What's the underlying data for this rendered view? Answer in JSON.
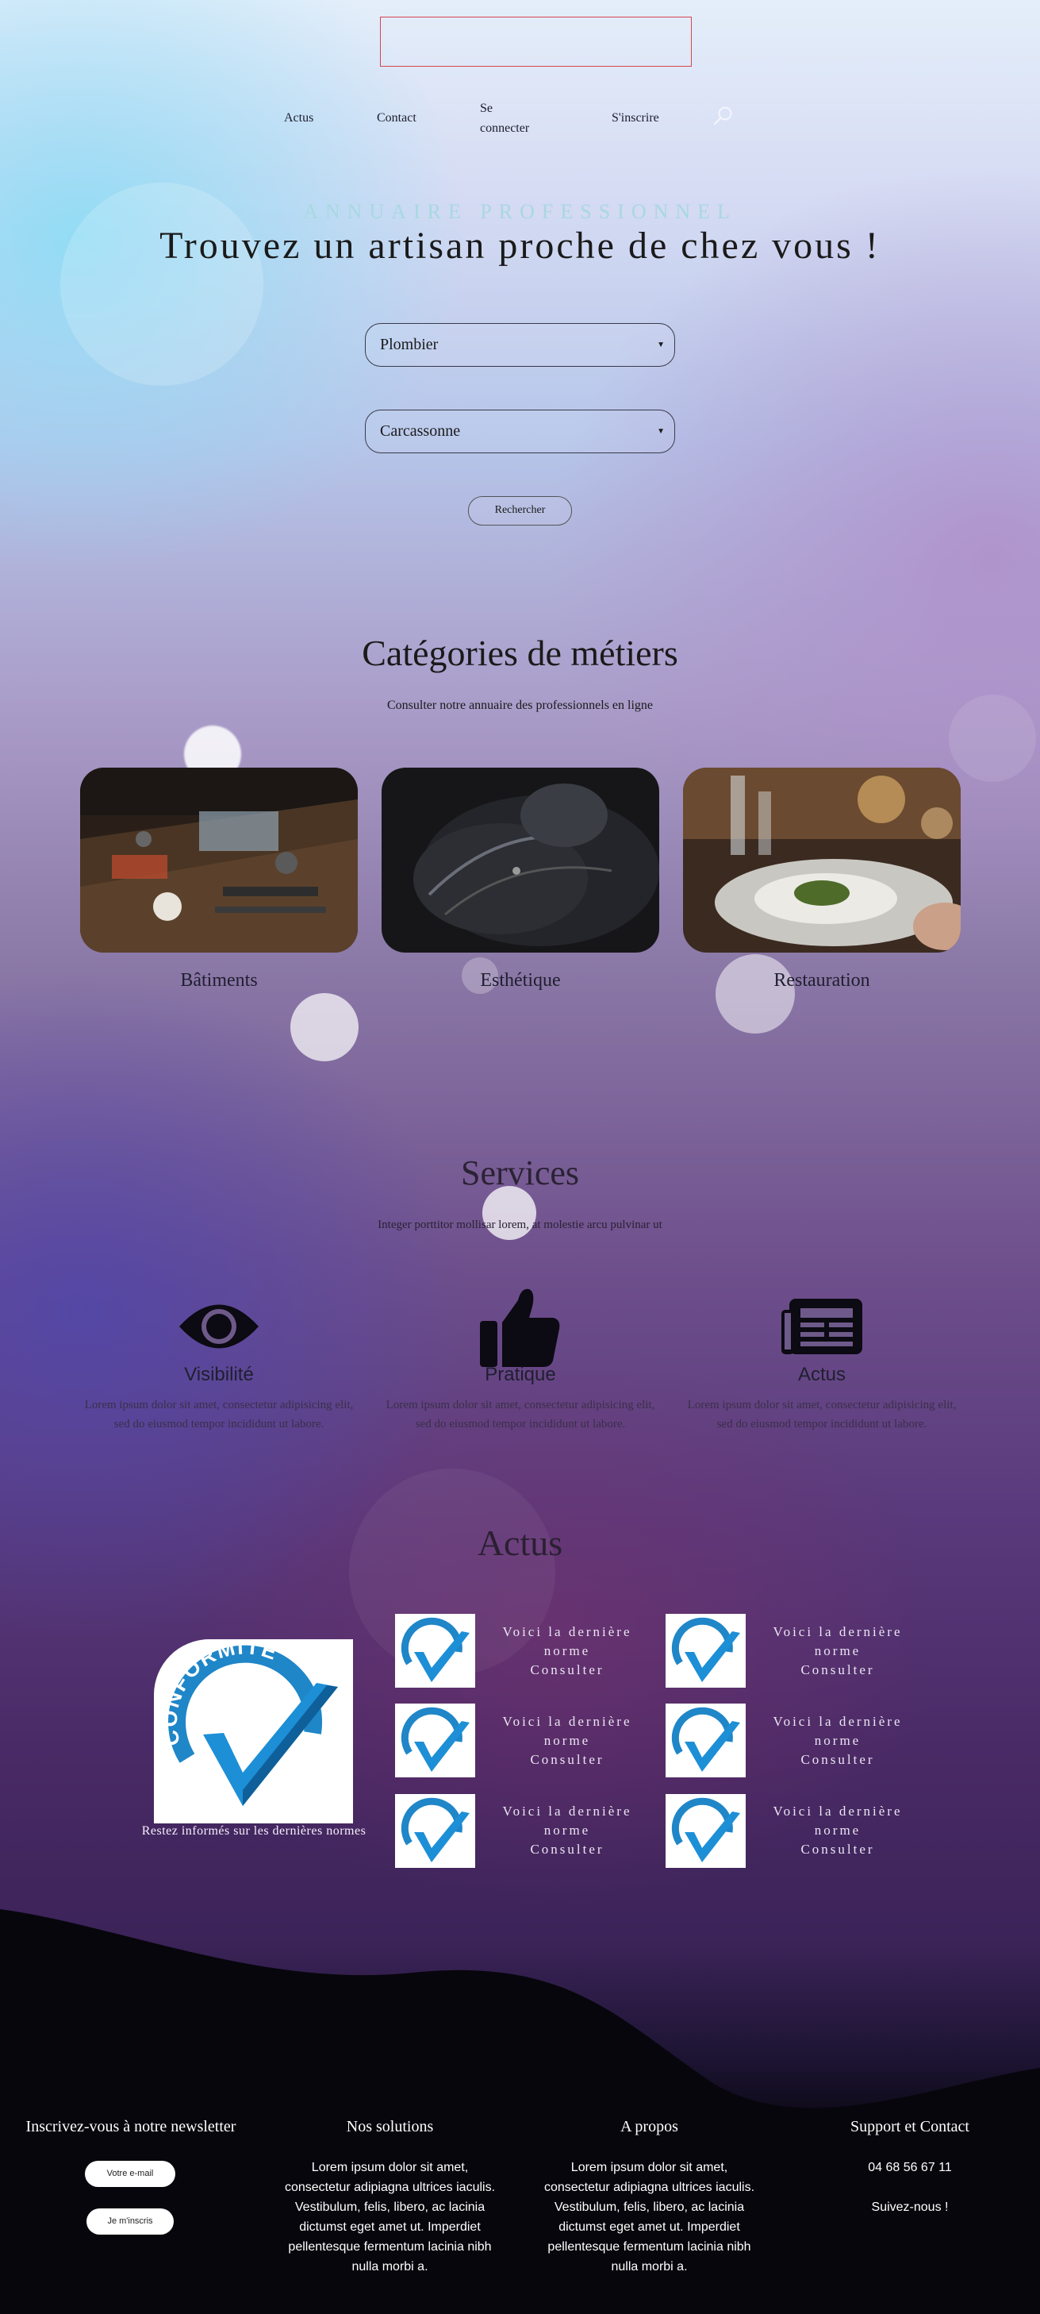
{
  "nav": {
    "items": [
      "Actus",
      "Contact",
      "Se connecter",
      "S'inscrire"
    ]
  },
  "hero": {
    "kicker": "ANNUAIRE PROFESSIONNEL",
    "title": "Trouvez un artisan proche de chez vous !",
    "trade_select": "Plombier",
    "city_select": "Carcassonne",
    "search_button": "Rechercher"
  },
  "categories": {
    "title": "Catégories de métiers",
    "subtitle": "Consulter notre annuaire des professionnels en ligne",
    "items": [
      {
        "label": "Bâtiments"
      },
      {
        "label": "Esthétique"
      },
      {
        "label": "Restauration"
      }
    ]
  },
  "services": {
    "title": "Services",
    "subtitle": "Integer porttitor mollisar lorem, at molestie arcu pulvinar ut",
    "items": [
      {
        "icon": "eye-icon",
        "title": "Visibilité",
        "text": "Lorem ipsum dolor sit amet, consectetur adipisicing elit, sed do eiusmod tempor incididunt ut labore."
      },
      {
        "icon": "thumbs-up-icon",
        "title": "Pratique",
        "text": "Lorem ipsum dolor sit amet, consectetur adipisicing elit, sed do eiusmod tempor incididunt ut labore."
      },
      {
        "icon": "newspaper-icon",
        "title": "Actus",
        "text": "Lorem ipsum dolor sit amet, consectetur adipisicing elit, sed do eiusmod tempor incididunt ut labore."
      }
    ]
  },
  "actus": {
    "title": "Actus",
    "feature_caption": "Restez informés sur les dernières normes",
    "badge_text": "CONFORMITÉ",
    "news": [
      {
        "line1": "Voici la dernière",
        "line2": "norme",
        "link": "Consulter"
      },
      {
        "line1": "Voici la dernière",
        "line2": "norme",
        "link": "Consulter"
      },
      {
        "line1": "Voici la dernière",
        "line2": "norme",
        "link": "Consulter"
      },
      {
        "line1": "Voici la dernière",
        "line2": "norme",
        "link": "Consulter"
      },
      {
        "line1": "Voici la dernière",
        "line2": "norme",
        "link": "Consulter"
      },
      {
        "line1": "Voici la dernière",
        "line2": "norme",
        "link": "Consulter"
      }
    ]
  },
  "footer": {
    "newsletter": {
      "title": "Inscrivez-vous à notre newsletter",
      "email_placeholder": "Votre e-mail",
      "subscribe_button": "Je m'inscris"
    },
    "solutions": {
      "title": "Nos solutions",
      "text": "Lorem ipsum dolor sit amet, consectetur adipiagna ultrices iaculis. Vestibulum, felis, libero, ac lacinia dictumst eget amet ut. Imperdiet pellentesque fermentum lacinia nibh nulla morbi a."
    },
    "about": {
      "title": "A propos",
      "text": "Lorem ipsum dolor sit amet, consectetur adipiagna ultrices iaculis. Vestibulum, felis, libero, ac lacinia dictumst eget amet ut. Imperdiet pellentesque fermentum lacinia nibh nulla morbi a."
    },
    "support": {
      "title": "Support et Contact",
      "phone": "04 68 56 67 11",
      "follow": "Suivez-nous !"
    }
  },
  "colors": {
    "logo_border": "#d8444c",
    "footer_bg": "#07060c",
    "conformite_blue": "#1f86c8"
  }
}
